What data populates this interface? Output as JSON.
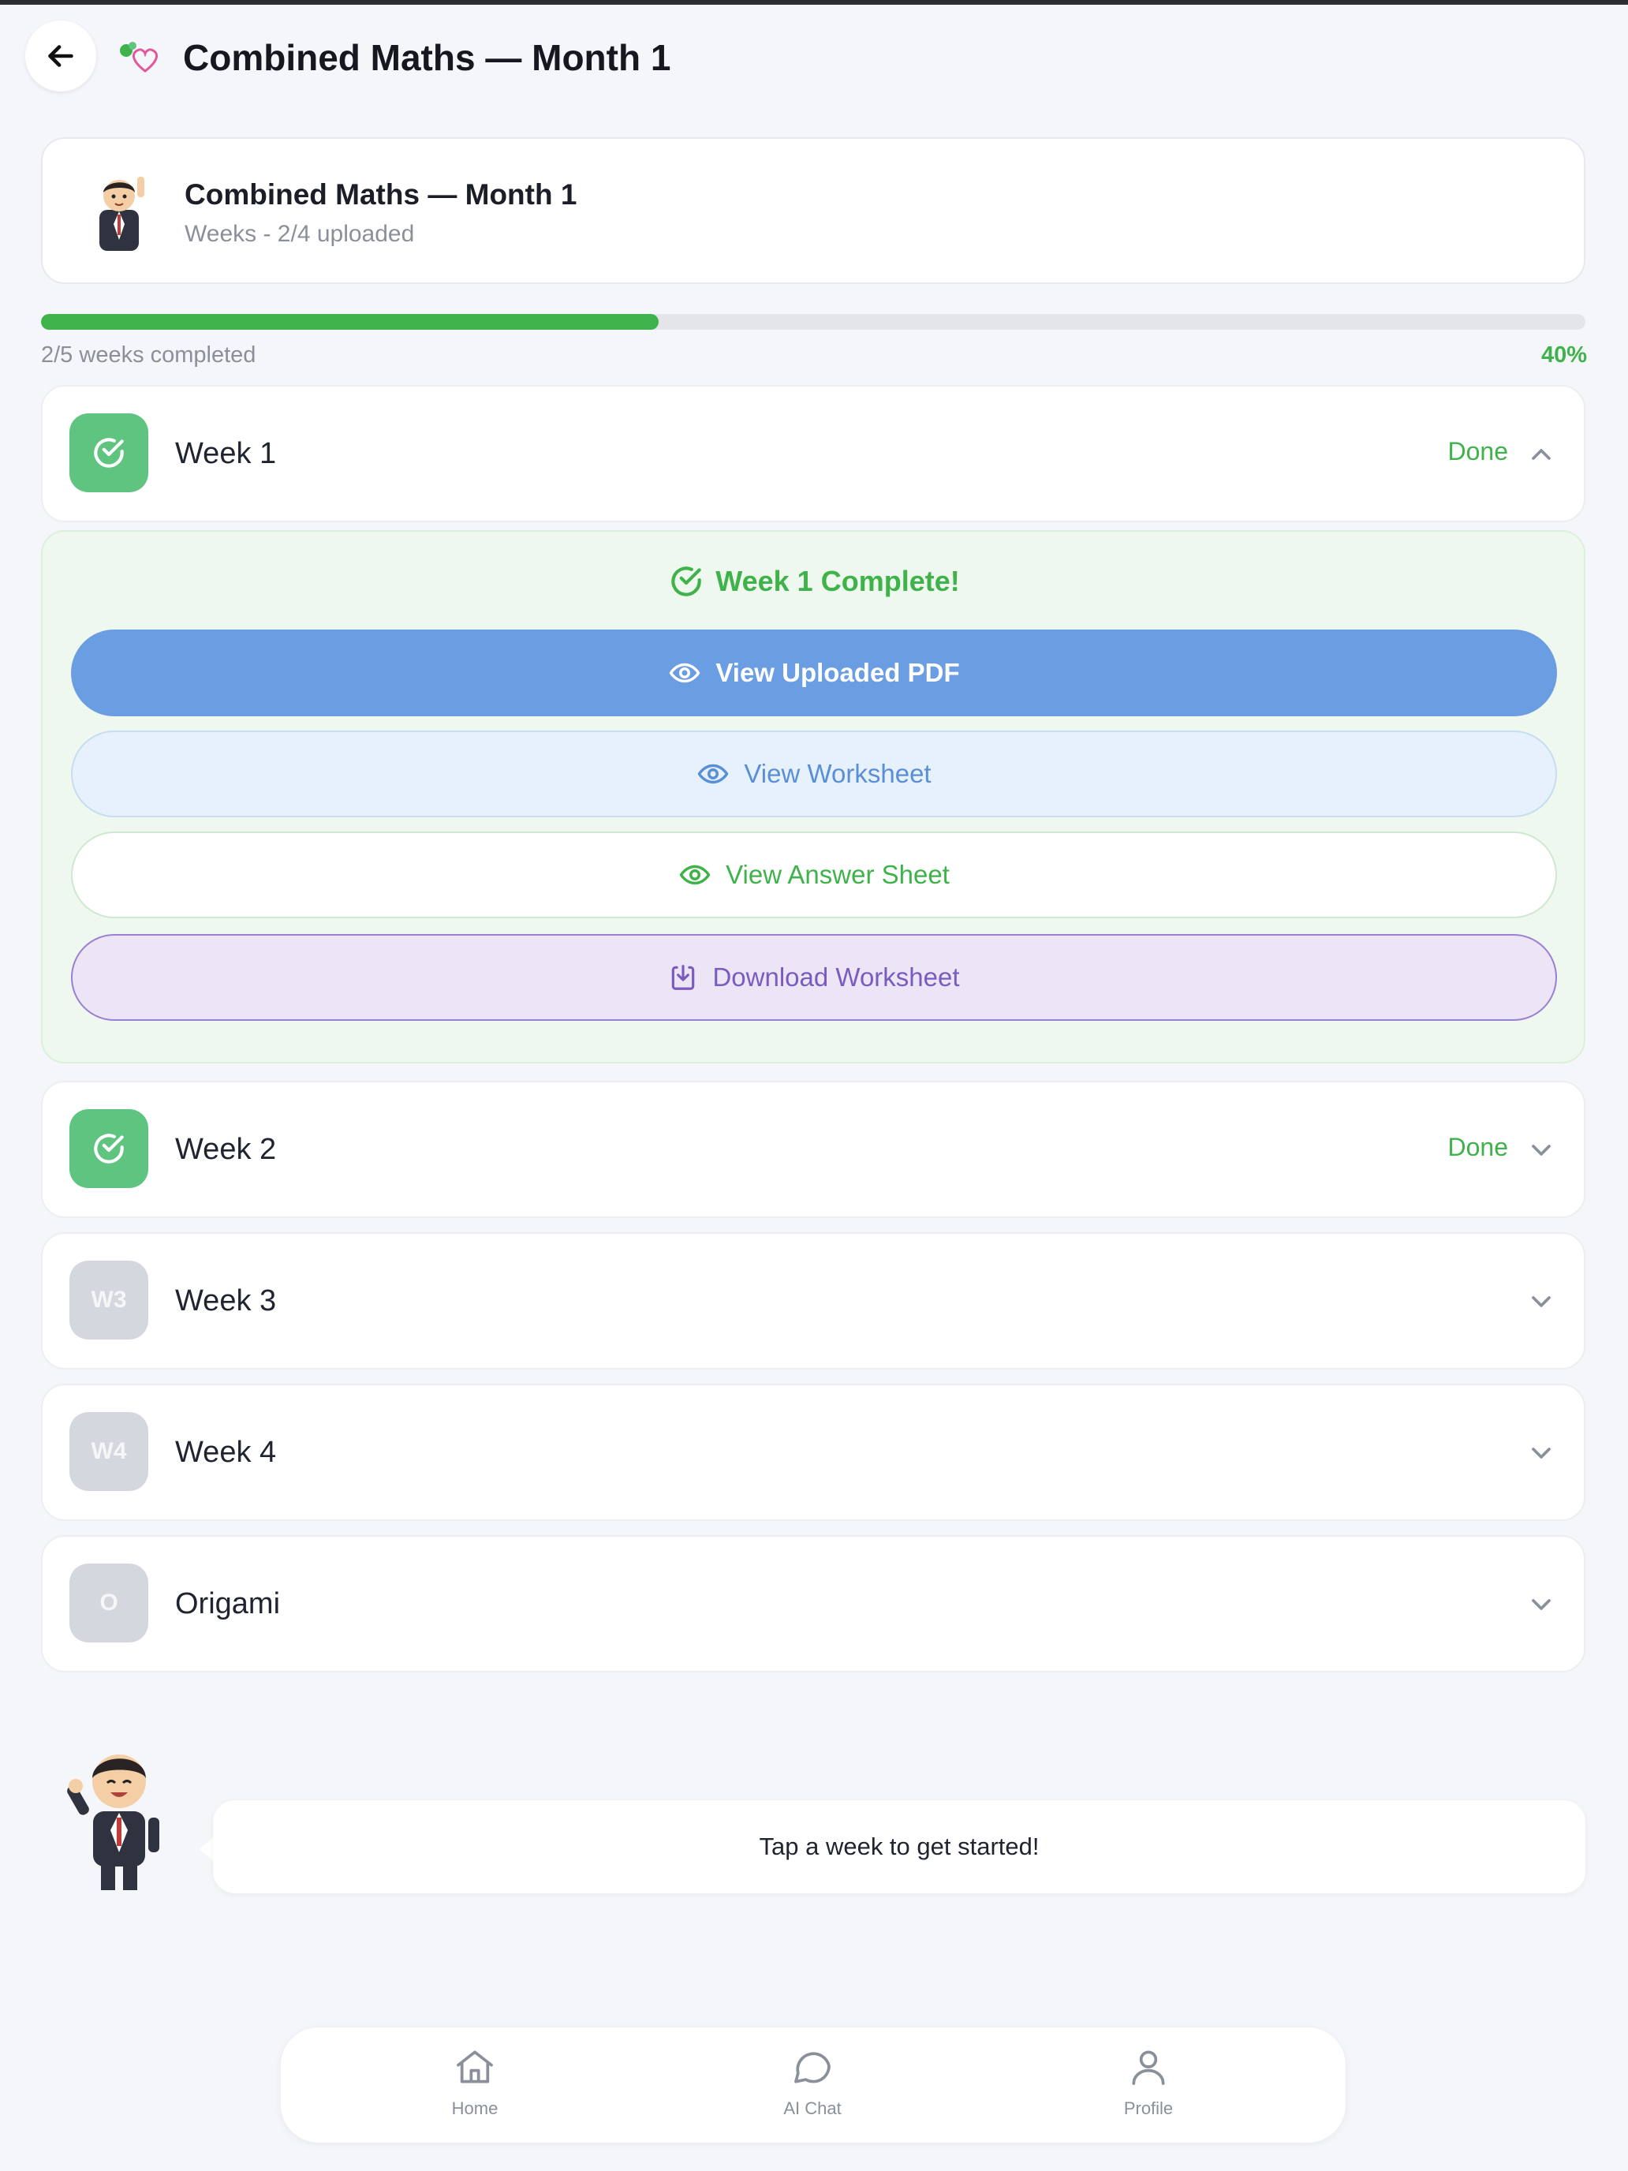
{
  "header": {
    "title": "Combined Maths — Month 1"
  },
  "course": {
    "title": "Combined Maths — Month 1",
    "subtitle": "Weeks - 2/4 uploaded"
  },
  "progress": {
    "text": "2/5 weeks completed",
    "percent_label": "40%",
    "fraction": 0.4
  },
  "weeks": [
    {
      "label": "Week 1",
      "status": "Done",
      "badge": "",
      "done": true,
      "expanded": true
    },
    {
      "label": "Week 2",
      "status": "Done",
      "badge": "",
      "done": true,
      "expanded": false
    },
    {
      "label": "Week 3",
      "status": "",
      "badge": "W3",
      "done": false,
      "expanded": false
    },
    {
      "label": "Week 4",
      "status": "",
      "badge": "W4",
      "done": false,
      "expanded": false
    },
    {
      "label": "Origami",
      "status": "",
      "badge": "O",
      "done": false,
      "expanded": false
    }
  ],
  "expanded_panel": {
    "complete_text": "Week 1 Complete!",
    "view_pdf": "View Uploaded PDF",
    "view_worksheet": "View Worksheet",
    "view_answer": "View Answer Sheet",
    "download_worksheet": "Download Worksheet"
  },
  "tip": {
    "text": "Tap a week to get started!"
  },
  "nav": {
    "home": "Home",
    "ai_chat": "AI Chat",
    "profile": "Profile"
  },
  "colors": {
    "accent_green": "#3fb24a",
    "done_badge": "#5ec47f",
    "pdf_button": "#6b9de2",
    "download_purple": "#7a5bbf"
  }
}
